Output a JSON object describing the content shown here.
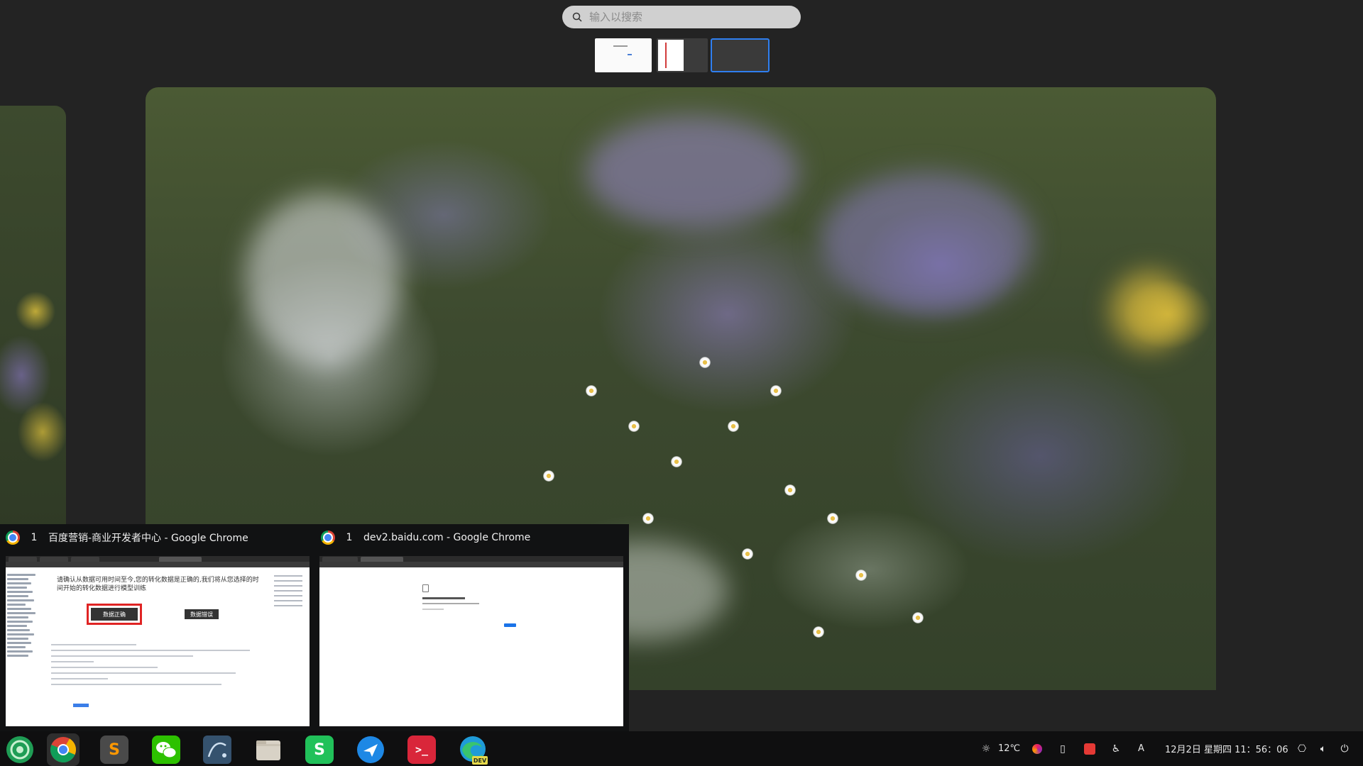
{
  "search": {
    "placeholder": "输入以搜索"
  },
  "workspaces": [
    {
      "label": "workspace-1",
      "active": false
    },
    {
      "label": "workspace-2",
      "active": false
    },
    {
      "label": "workspace-3",
      "active": true
    }
  ],
  "switcher": {
    "windows": [
      {
        "number": "1",
        "title": "百度营销-商业开发者中心 - Google Chrome",
        "preview": {
          "dialog_text": "请确认从数据可用时间至今,您的转化数据是正确的,我们将从您选择的时间开始的转化数据进行模型训练",
          "ok_button": "数据正确",
          "error_button": "数据错误"
        }
      },
      {
        "number": "1",
        "title": "dev2.baidu.com - Google Chrome"
      }
    ]
  },
  "taskbar": {
    "apps": [
      {
        "name": "launcher",
        "icon": "launcher-icon",
        "color": "#2fb35a"
      },
      {
        "name": "Google Chrome",
        "icon": "chrome-icon",
        "active": true
      },
      {
        "name": "Sublime Text",
        "icon": "sublime-icon",
        "color": "#ff9800",
        "glyph": "S"
      },
      {
        "name": "WeChat",
        "icon": "wechat-icon",
        "color": "#2dc100"
      },
      {
        "name": "MySQL Workbench",
        "icon": "mysql-workbench-icon",
        "color": "#3b5b7a"
      },
      {
        "name": "Files",
        "icon": "files-icon",
        "color": "#d6d0c4"
      },
      {
        "name": "WPS",
        "icon": "wps-icon",
        "color": "#21c15a",
        "glyph": "S"
      },
      {
        "name": "Feishu",
        "icon": "feishu-icon",
        "color": "#1e88e5"
      },
      {
        "name": "Terminal",
        "icon": "terminal-icon",
        "color": "#d9263a",
        "glyph": ">_"
      },
      {
        "name": "Microsoft Edge Dev",
        "icon": "edge-dev-icon",
        "color": "#1f9bd8",
        "badge": "DEV"
      }
    ],
    "tray": {
      "temperature": "12℃",
      "input_method": "A",
      "datetime": "12月2日 星期四  11：56：06"
    }
  }
}
